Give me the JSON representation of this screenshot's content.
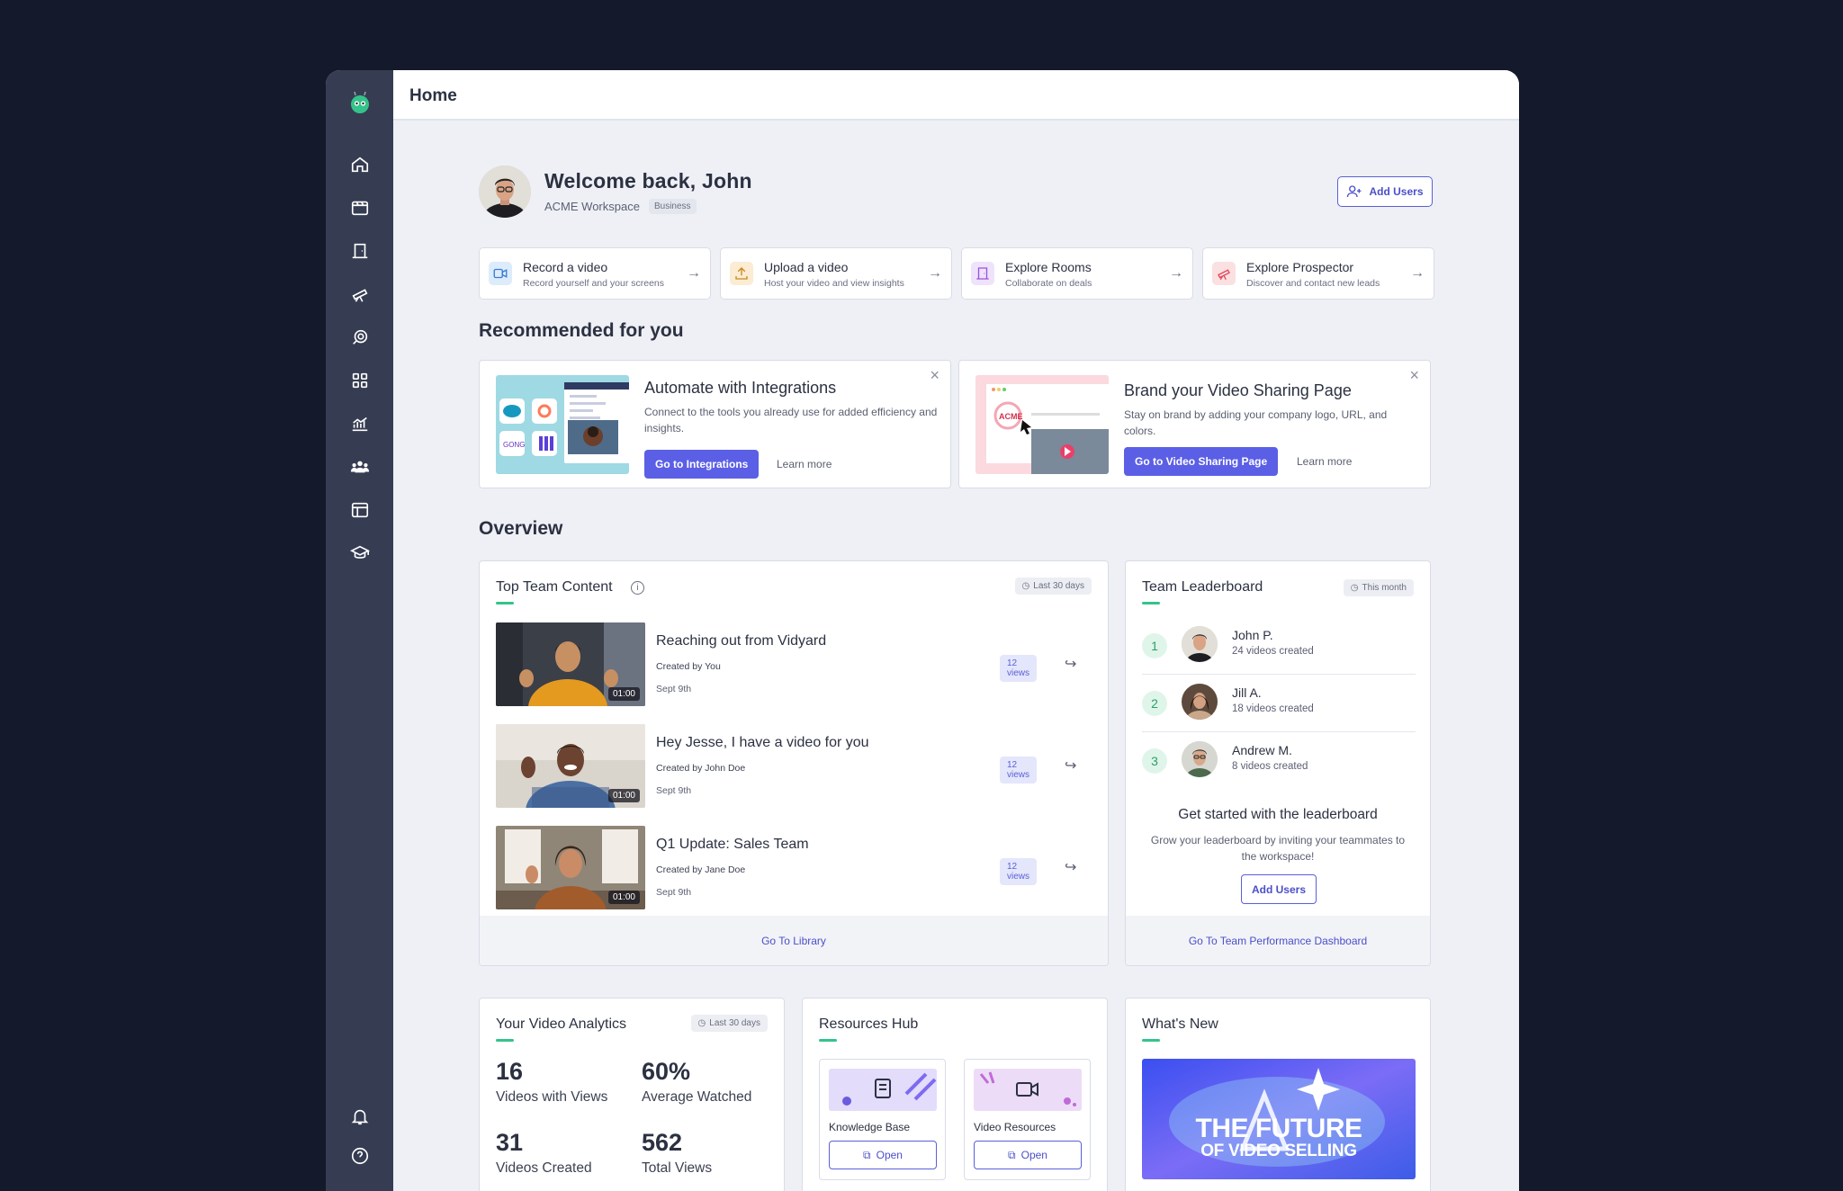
{
  "topbar": {
    "title": "Home"
  },
  "welcome": {
    "title": "Welcome back, John",
    "workspace": "ACME Workspace",
    "plan": "Business",
    "add_users": "Add Users"
  },
  "actions": [
    {
      "title": "Record a video",
      "subtitle": "Record yourself and your screens",
      "icon": "video-camera-icon",
      "color": "#dcecfb"
    },
    {
      "title": "Upload a video",
      "subtitle": "Host your video and view insights",
      "icon": "upload-icon",
      "color": "#fbecd3"
    },
    {
      "title": "Explore Rooms",
      "subtitle": "Collaborate on deals",
      "icon": "door-icon",
      "color": "#efe3fb"
    },
    {
      "title": "Explore Prospector",
      "subtitle": "Discover and contact new leads",
      "icon": "telescope-icon",
      "color": "#fbe0e2"
    }
  ],
  "recommended": {
    "title": "Recommended for you",
    "cards": [
      {
        "title": "Automate with Integrations",
        "desc": "Connect to the tools you already use for added efficiency and insights.",
        "button": "Go to Integrations",
        "learn": "Learn more"
      },
      {
        "title": "Brand your Video Sharing Page",
        "desc": "Stay on brand by adding your company logo, URL, and colors.",
        "button": "Go to Video Sharing Page",
        "learn": "Learn more",
        "logo_text": "ACME"
      }
    ]
  },
  "overview": {
    "title": "Overview",
    "top_content": {
      "title": "Top Team Content",
      "range": "Last 30 days",
      "videos": [
        {
          "title": "Reaching out from Vidyard",
          "by": "Created by You",
          "date": "Sept 9th",
          "views": "12 views",
          "duration": "01:00"
        },
        {
          "title": "Hey Jesse, I have a video for you",
          "by": "Created by John Doe",
          "date": "Sept 9th",
          "views": "12 views",
          "duration": "01:00"
        },
        {
          "title": "Q1 Update: Sales Team",
          "by": "Created by Jane Doe",
          "date": "Sept 9th",
          "views": "12 views",
          "duration": "01:00"
        }
      ],
      "footer": "Go To Library"
    },
    "leaderboard": {
      "title": "Team Leaderboard",
      "range": "This month",
      "entries": [
        {
          "rank": "1",
          "name": "John P.",
          "sub": "24 videos created"
        },
        {
          "rank": "2",
          "name": "Jill A.",
          "sub": "18 videos created"
        },
        {
          "rank": "3",
          "name": "Andrew M.",
          "sub": "8 videos created"
        }
      ],
      "cta_title": "Get started with the leaderboard",
      "cta_desc": "Grow your leaderboard by inviting your teammates to the workspace!",
      "cta_button": "Add Users",
      "footer": "Go To Team Performance Dashboard"
    }
  },
  "analytics": {
    "title": "Your Video Analytics",
    "range": "Last 30 days",
    "stats": [
      {
        "value": "16",
        "label": "Videos with Views"
      },
      {
        "value": "60%",
        "label": "Average Watched"
      },
      {
        "value": "31",
        "label": "Videos Created"
      },
      {
        "value": "562",
        "label": "Total Views"
      }
    ]
  },
  "resources": {
    "title": "Resources Hub",
    "items": [
      {
        "label": "Knowledge Base",
        "open": "Open"
      },
      {
        "label": "Video Resources",
        "open": "Open"
      }
    ]
  },
  "whats_new": {
    "title": "What's New",
    "banner_line1": "THE FUTURE",
    "banner_line2": "OF VIDEO SELLING"
  }
}
